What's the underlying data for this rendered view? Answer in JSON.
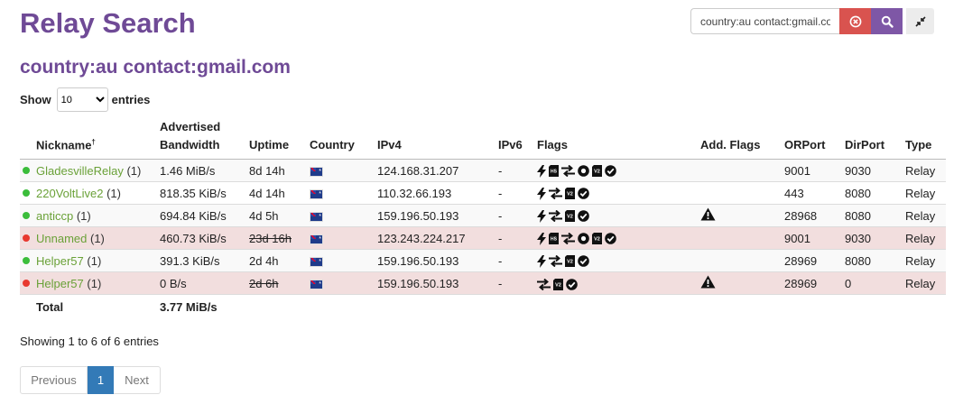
{
  "app_title": "Relay Search",
  "query_title": "country:au contact:gmail.com",
  "search": {
    "value": "country:au contact:gmail.com"
  },
  "length_menu": {
    "prefix": "Show",
    "selected": "10",
    "suffix": "entries"
  },
  "columns": {
    "nickname": "Nickname",
    "nickname_mark": "†",
    "bandwidth_line1": "Advertised",
    "bandwidth_line2": "Bandwidth",
    "uptime": "Uptime",
    "country": "Country",
    "ipv4": "IPv4",
    "ipv6": "IPv6",
    "flags": "Flags",
    "add_flags": "Add. Flags",
    "orport": "ORPort",
    "dirport": "DirPort",
    "type": "Type"
  },
  "rows": [
    {
      "status": "up",
      "nickname": "GladesvilleRelay",
      "count": "(1)",
      "bandwidth": "1.46 MiB/s",
      "uptime": "8d 14h",
      "uptime_struck": false,
      "country_icon": "australia-flag-icon",
      "ipv4": "124.168.31.207",
      "ipv6": "-",
      "flags": [
        "fast-icon",
        "hsdir-icon",
        "stable-icon",
        "guard-icon",
        "v2dir-icon",
        "valid-icon"
      ],
      "warning": false,
      "orport": "9001",
      "dirport": "9030",
      "type": "Relay"
    },
    {
      "status": "up",
      "nickname": "220VoltLive2",
      "count": "(1)",
      "bandwidth": "818.35 KiB/s",
      "uptime": "4d 14h",
      "uptime_struck": false,
      "country_icon": "australia-flag-icon",
      "ipv4": "110.32.66.193",
      "ipv6": "-",
      "flags": [
        "fast-icon",
        "stable-icon",
        "v2dir-icon",
        "valid-icon"
      ],
      "warning": false,
      "orport": "443",
      "dirport": "8080",
      "type": "Relay"
    },
    {
      "status": "up",
      "nickname": "anticcp",
      "count": "(1)",
      "bandwidth": "694.84 KiB/s",
      "uptime": "4d 5h",
      "uptime_struck": false,
      "country_icon": "australia-flag-icon",
      "ipv4": "159.196.50.193",
      "ipv6": "-",
      "flags": [
        "fast-icon",
        "stable-icon",
        "v2dir-icon",
        "valid-icon"
      ],
      "warning": true,
      "orport": "28968",
      "dirport": "8080",
      "type": "Relay"
    },
    {
      "status": "down",
      "nickname": "Unnamed",
      "count": "(1)",
      "bandwidth": "460.73 KiB/s",
      "uptime": "23d 16h",
      "uptime_struck": true,
      "country_icon": "australia-flag-icon",
      "ipv4": "123.243.224.217",
      "ipv6": "-",
      "flags": [
        "fast-icon",
        "hsdir-icon",
        "stable-icon",
        "guard-icon",
        "v2dir-icon",
        "valid-icon"
      ],
      "warning": false,
      "orport": "9001",
      "dirport": "9030",
      "type": "Relay"
    },
    {
      "status": "up",
      "nickname": "Helper57",
      "count": "(1)",
      "bandwidth": "391.3 KiB/s",
      "uptime": "2d 4h",
      "uptime_struck": false,
      "country_icon": "australia-flag-icon",
      "ipv4": "159.196.50.193",
      "ipv6": "-",
      "flags": [
        "fast-icon",
        "stable-icon",
        "v2dir-icon",
        "valid-icon"
      ],
      "warning": false,
      "orport": "28969",
      "dirport": "8080",
      "type": "Relay"
    },
    {
      "status": "down",
      "nickname": "Helper57",
      "count": "(1)",
      "bandwidth": "0 B/s",
      "uptime": "2d 6h",
      "uptime_struck": true,
      "country_icon": "australia-flag-icon",
      "ipv4": "159.196.50.193",
      "ipv6": "-",
      "flags": [
        "stable-icon",
        "v2dir-icon",
        "valid-icon"
      ],
      "warning": true,
      "orport": "28969",
      "dirport": "0",
      "type": "Relay"
    }
  ],
  "total": {
    "label": "Total",
    "bandwidth": "3.77 MiB/s"
  },
  "info": "Showing 1 to 6 of 6 entries",
  "pagination": {
    "previous": "Previous",
    "current": "1",
    "next": "Next"
  }
}
